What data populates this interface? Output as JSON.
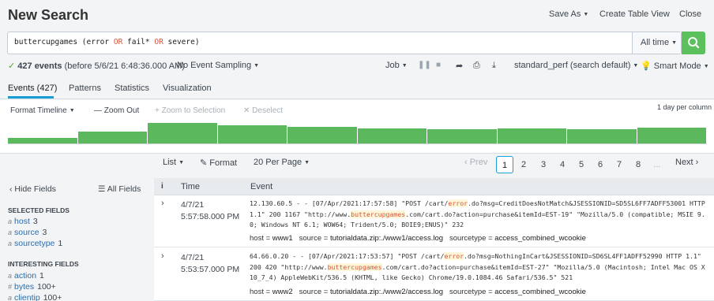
{
  "header": {
    "title": "New Search",
    "save_as": "Save As",
    "create_table_view": "Create Table View",
    "close": "Close"
  },
  "search": {
    "query_pre": "buttercupgames (error ",
    "kw1": "OR",
    "mid1": " fail* ",
    "kw2": "OR",
    "mid2": " severe)",
    "time_range": "All time",
    "search_icon": "magnifier-icon",
    "search_button_color": "#5cc05c"
  },
  "status": {
    "check": "✓",
    "events_count": "427 events",
    "events_before": "(before 5/6/21 6:48:36.000 AM)",
    "sampling": "No Event Sampling",
    "job": "Job",
    "mode": "standard_perf (search default)",
    "smart_mode": "Smart Mode"
  },
  "tabs": [
    "Events (427)",
    "Patterns",
    "Statistics",
    "Visualization"
  ],
  "timeline": {
    "format": "Format Timeline",
    "zoom_out": "— Zoom Out",
    "zoom_selection": "+ Zoom to Selection",
    "deselect": "✕ Deselect",
    "scale": "1 day per column",
    "bar_color": "#5cb85c",
    "bars": [
      0.25,
      0.55,
      0.95,
      0.85,
      0.78,
      0.72,
      0.65,
      0.7,
      0.68,
      0.75
    ]
  },
  "pager": {
    "list": "List",
    "format": "Format",
    "per_page": "20 Per Page",
    "prev": "‹ Prev",
    "pages": [
      "1",
      "2",
      "3",
      "4",
      "5",
      "6",
      "7",
      "8",
      "..."
    ],
    "next": "Next ›"
  },
  "sidebar": {
    "hide_fields": "‹ Hide Fields",
    "all_fields": "All Fields",
    "selected_head": "SELECTED FIELDS",
    "selected": [
      {
        "type": "a",
        "name": "host",
        "count": "3"
      },
      {
        "type": "a",
        "name": "source",
        "count": "3"
      },
      {
        "type": "a",
        "name": "sourcetype",
        "count": "1"
      }
    ],
    "interesting_head": "INTERESTING FIELDS",
    "interesting": [
      {
        "type": "a",
        "name": "action",
        "count": "1"
      },
      {
        "type": "#",
        "name": "bytes",
        "count": "100+"
      },
      {
        "type": "a",
        "name": "clientip",
        "count": "100+"
      }
    ]
  },
  "table": {
    "col_info": "i",
    "col_time": "Time",
    "col_event": "Event",
    "events": [
      {
        "date": "4/7/21",
        "time": "5:57:58.000 PM",
        "l1a": "12.130.60.5 - - [07/Apr/2021:17:57:58] \"POST /cart/",
        "l1hl": "error",
        "l1b": ".do?msg=CreditDoesNotMatch&JSESSIONID=SD5SL6FF7ADFF53001 HTTP",
        "l2a": "1.1\" 200 1167 \"http://www.",
        "l2hl": "buttercupgames",
        "l2b": ".com/cart.do?action=purchase&itemId=EST-19\" \"Mozilla/5.0 (compatible; MSIE 9.",
        "l3": "0; Windows NT 6.1; WOW64; Trident/5.0; BOIE9;ENUS)\" 232",
        "host_label": "host = ",
        "host": "www1",
        "source_label": "source = ",
        "source": "tutorialdata.zip:./www1/access.log",
        "st_label": "sourcetype = ",
        "sourcetype": "access_combined_wcookie"
      },
      {
        "date": "4/7/21",
        "time": "5:53:57.000 PM",
        "l1a": "64.66.0.20 - - [07/Apr/2021:17:53:57] \"POST /cart/",
        "l1hl": "error",
        "l1b": ".do?msg=NothingInCart&JSESSIONID=SD6SL4FF1ADFF52990 HTTP 1.1\"",
        "l2a": "200 420 \"http://www.",
        "l2hl": "buttercupgames",
        "l2b": ".com/cart.do?action=purchase&itemId=EST-27\" \"Mozilla/5.0 (Macintosh; Intel Mac OS X",
        "l3": "10_7_4) AppleWebKit/536.5 (KHTML, like Gecko) Chrome/19.0.1084.46 Safari/536.5\" 521",
        "host_label": "host = ",
        "host": "www2",
        "source_label": "source = ",
        "source": "tutorialdata.zip:./www2/access.log",
        "st_label": "sourcetype = ",
        "sourcetype": "access_combined_wcookie"
      }
    ]
  }
}
